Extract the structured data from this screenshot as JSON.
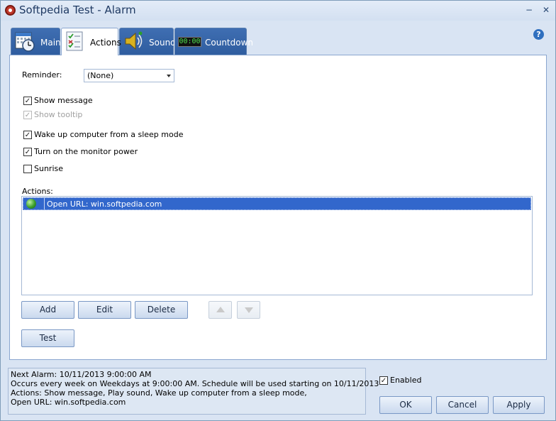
{
  "window": {
    "title": "Softpedia Test - Alarm",
    "minimize": "−",
    "close": "✕"
  },
  "tabs": [
    {
      "label": "Main",
      "icon": "calendar-clock-icon"
    },
    {
      "label": "Actions",
      "icon": "checklist-icon",
      "active": true
    },
    {
      "label": "Sound",
      "icon": "speaker-icon"
    },
    {
      "label": "Countdown",
      "icon": "digital-clock-icon",
      "display": "00:00"
    }
  ],
  "help": "?",
  "reminder": {
    "label": "Reminder:",
    "value": "(None)"
  },
  "checkboxes": [
    {
      "label": "Show message",
      "checked": true,
      "enabled": true
    },
    {
      "label": "Show tooltip",
      "checked": true,
      "enabled": false
    },
    {
      "label": "Wake up computer from a sleep mode",
      "checked": true,
      "enabled": true
    },
    {
      "label": "Turn on the monitor power",
      "checked": true,
      "enabled": true
    },
    {
      "label": "Sunrise",
      "checked": false,
      "enabled": true
    }
  ],
  "actions": {
    "label": "Actions:",
    "items": [
      {
        "text": "Open URL: win.softpedia.com",
        "icon": "globe-icon",
        "selected": true
      }
    ]
  },
  "buttons": {
    "add": "Add",
    "edit": "Edit",
    "delete": "Delete",
    "test": "Test",
    "ok": "OK",
    "cancel": "Cancel",
    "apply": "Apply"
  },
  "status": {
    "line1": "Next Alarm: 10/11/2013 9:00:00 AM",
    "line2": "Occurs every week on Weekdays at 9:00:00 AM. Schedule will be used starting on 10/11/2013",
    "line3": "Actions: Show message, Play sound, Wake up computer from a sleep mode,",
    "line4": "Open URL: win.softpedia.com"
  },
  "enabled": {
    "label": "Enabled",
    "checked": true
  },
  "colors": {
    "selection": "#3267cc",
    "tab_active": "#ffffff",
    "tab_inactive": "#2f5d9f",
    "window_bg": "#d9e4f3"
  }
}
